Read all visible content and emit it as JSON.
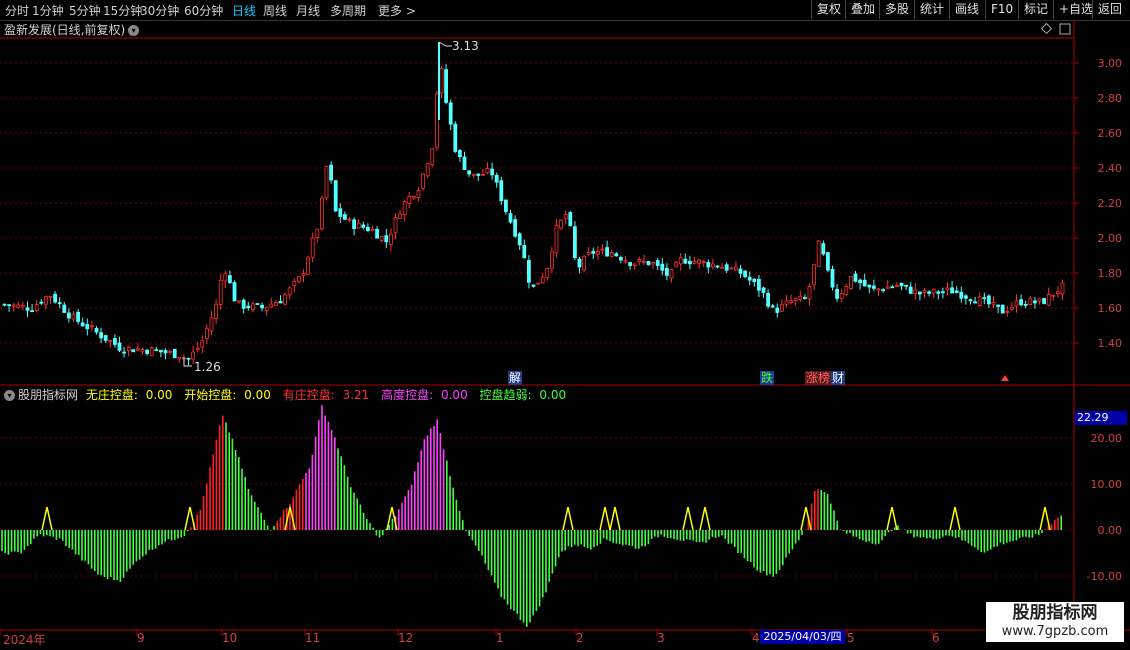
{
  "toolbar": {
    "periods": [
      "分时",
      "1分钟",
      "5分钟",
      "15分钟",
      "30分钟",
      "60分钟",
      "日线",
      "周线",
      "月线",
      "多周期",
      "更多 >"
    ],
    "active_period": "日线",
    "buttons": [
      "复权",
      "叠加",
      "多股",
      "统计",
      "画线",
      "F10",
      "标记",
      "+自选",
      "返回"
    ]
  },
  "main_chart": {
    "title": "盈新发展(日线,前复权)",
    "high_label": "3.13",
    "low_label": "1.26",
    "y_ticks": [
      "3.00",
      "2.80",
      "2.60",
      "2.40",
      "2.20",
      "2.00",
      "1.80",
      "1.60",
      "1.40"
    ],
    "event_tags": [
      {
        "text": "解",
        "color": "#ffffff",
        "bg": "#1e3a8a"
      },
      {
        "text": "跌",
        "color": "#40ff40",
        "bg": "#1e3a8a"
      },
      {
        "text": "涨榜",
        "color": "#ff6060",
        "bg": "#5a1a1a"
      },
      {
        "text": "财",
        "color": "#ffffff",
        "bg": "#1e3a8a"
      }
    ]
  },
  "indicator": {
    "name": "股朋指标网",
    "items": [
      {
        "label": "无庄控盘:",
        "value": "0.00",
        "color": "#ffff00"
      },
      {
        "label": "开始控盘:",
        "value": "0.00",
        "color": "#ffff00"
      },
      {
        "label": "有庄控盘:",
        "value": "3.21",
        "color": "#ff3030"
      },
      {
        "label": "高度控盘:",
        "value": "0.00",
        "color": "#ff40ff"
      },
      {
        "label": "控盘趋弱:",
        "value": "0.00",
        "color": "#40ff40"
      }
    ],
    "current_value": "22.29",
    "y_ticks": [
      "20.00",
      "10.00",
      "0.00",
      "-10.00"
    ]
  },
  "x_axis": {
    "labels": [
      "2024年",
      "9",
      "10",
      "11",
      "12",
      "1",
      "2",
      "3",
      "4",
      "5",
      "6"
    ],
    "cursor_date": "2025/04/03/四"
  },
  "watermark": {
    "line1": "股朋指标网",
    "line2": "www.7gpzb.com"
  },
  "colors": {
    "up": "#ff3030",
    "down": "#54ffff",
    "grid": "#7a0000",
    "axis": "#b00000"
  }
}
